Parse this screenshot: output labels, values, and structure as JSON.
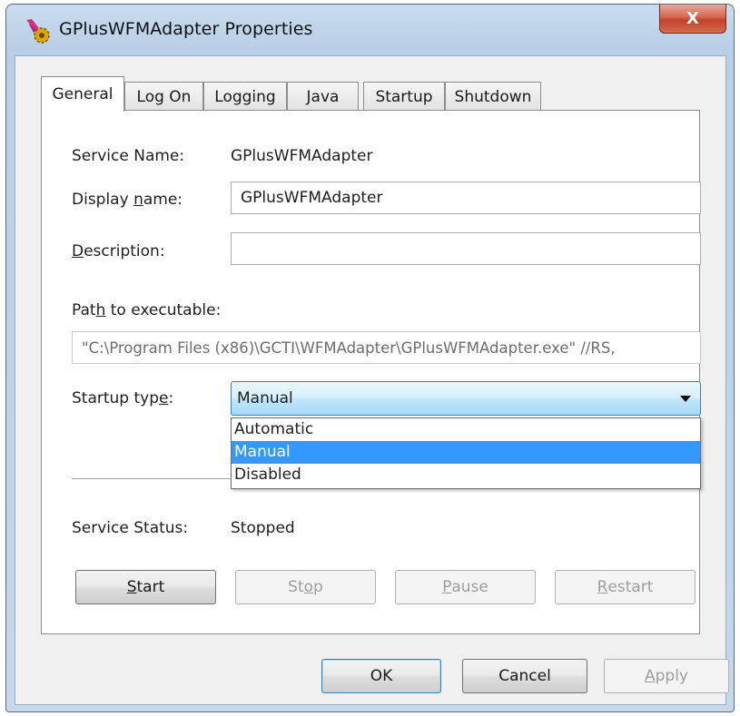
{
  "window": {
    "title": "GPlusWFMAdapter Properties",
    "close_label": "X"
  },
  "tabs": [
    {
      "label": "General",
      "active": true
    },
    {
      "label": "Log On"
    },
    {
      "label": "Logging"
    },
    {
      "label": "Java"
    },
    {
      "label": "Startup"
    },
    {
      "label": "Shutdown"
    }
  ],
  "general": {
    "service_name_label": "Service Name:",
    "service_name_value": "GPlusWFMAdapter",
    "display_name_label_a": "Display ",
    "display_name_label_u": "n",
    "display_name_label_b": "ame:",
    "display_name_value": "GPlusWFMAdapter",
    "description_label_u": "D",
    "description_label_b": "escription:",
    "description_value": "",
    "path_label_a": "Pat",
    "path_label_u": "h",
    "path_label_b": " to executable:",
    "path_value": "\"C:\\Program Files (x86)\\GCTI\\WFMAdapter\\GPlusWFMAdapter.exe\" //RS,",
    "startup_type_label_a": "Startup typ",
    "startup_type_label_u": "e",
    "startup_type_label_b": ":",
    "startup_type_value": "Manual",
    "startup_options": [
      "Automatic",
      "Manual",
      "Disabled"
    ],
    "startup_selected_index": 1,
    "service_status_label": "Service Status:",
    "service_status_value": "Stopped"
  },
  "service_buttons": {
    "start_u": "S",
    "start_b": "tart",
    "stop_a": "St",
    "stop_u": "o",
    "stop_b": "p",
    "pause_u": "P",
    "pause_b": "ause",
    "restart_u": "R",
    "restart_b": "estart"
  },
  "dialog_buttons": {
    "ok": "OK",
    "cancel": "Cancel",
    "apply_u": "A",
    "apply_b": "pply"
  },
  "colors": {
    "selection": "#3399ff",
    "close_button": "#c2412a"
  }
}
